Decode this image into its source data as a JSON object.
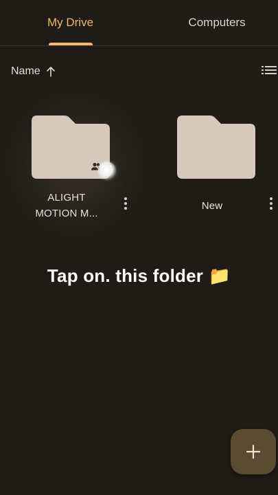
{
  "tabs": [
    {
      "label": "My Drive",
      "active": true
    },
    {
      "label": "Computers",
      "active": false
    }
  ],
  "sort": {
    "label": "Name",
    "direction_icon": "arrow-up-icon"
  },
  "view_toggle_icon": "list-view-icon",
  "folders": [
    {
      "name": "ALIGHT MOTION M...",
      "shared": true,
      "shared_icon": "people-icon"
    },
    {
      "name": "New",
      "shared": false
    }
  ],
  "caption": "Tap on. this folder 📁",
  "fab_icon": "plus-icon",
  "colors": {
    "background": "#1f1b16",
    "accent": "#f3b66b",
    "folder": "#d6c9bb",
    "fab": "#5b4b33"
  }
}
